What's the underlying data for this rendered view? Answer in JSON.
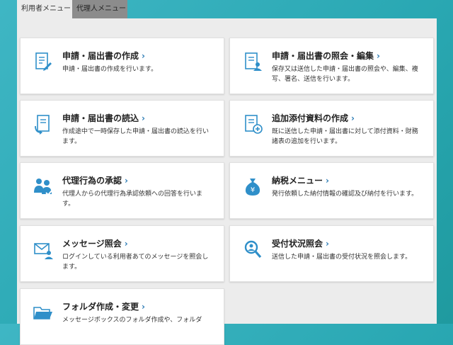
{
  "tabs": [
    {
      "label": "利用者メニュー"
    },
    {
      "label": "代理人メニュー"
    }
  ],
  "cards": [
    {
      "title": "申請・届出書の作成",
      "desc": "申請・届出書の作成を行います。",
      "icon": "document-pen-icon"
    },
    {
      "title": "申請・届出書の照会・編集",
      "desc": "保存又は送信した申請・届出書の照会や、編集、複写、署名、送信を行います。",
      "icon": "document-person-icon"
    },
    {
      "title": "申請・届出書の読込",
      "desc": "作成途中で一時保存した申請・届出書の読込を行います。",
      "icon": "document-load-icon"
    },
    {
      "title": "追加添付資料の作成",
      "desc": "既に送信した申請・届出書に対して添付資料・財務諸表の追加を行います。",
      "icon": "document-add-icon"
    },
    {
      "title": "代理行為の承認",
      "desc": "代理人からの代理行為承認依頼への回答を行います。",
      "icon": "agent-approval-icon"
    },
    {
      "title": "納税メニュー",
      "desc": "発行依頼した納付情報の確認及び納付を行います。",
      "icon": "yen-bag-icon"
    },
    {
      "title": "メッセージ照会",
      "desc": "ログインしている利用者あてのメッセージを照会します。",
      "icon": "mail-person-icon"
    },
    {
      "title": "受付状況照会",
      "desc": "送信した申請・届出書の受付状況を照会します。",
      "icon": "person-search-icon"
    },
    {
      "title": "フォルダ作成・変更",
      "desc": "メッセージボックスのフォルダ作成や、フォルダ",
      "icon": "folder-icon"
    }
  ],
  "colors": {
    "icon_blue": "#2f8fc9",
    "chevron": "#2b7bb5"
  }
}
